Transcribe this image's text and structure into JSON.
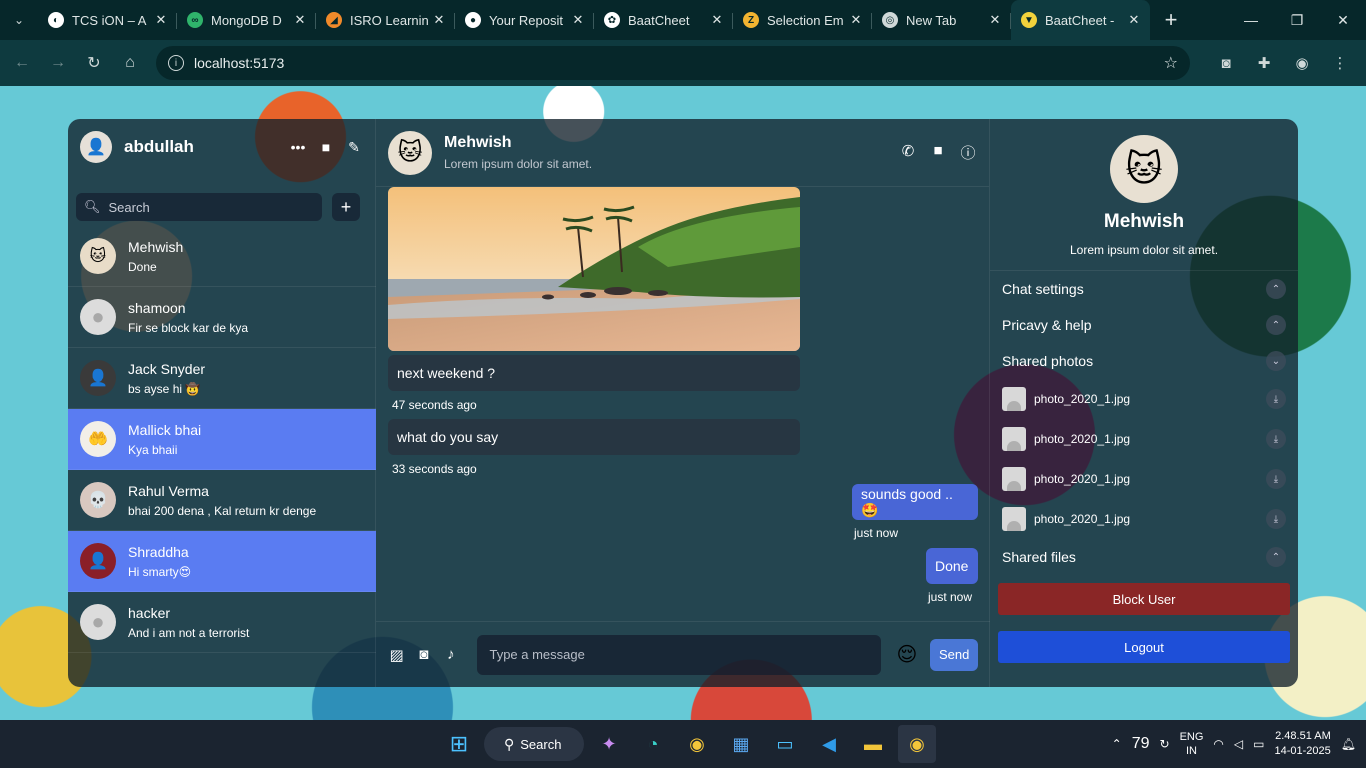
{
  "browser": {
    "tabs": [
      {
        "title": "TCS iON – A",
        "color": "#ffffff",
        "active": false
      },
      {
        "title": "MongoDB D",
        "color": "#2fb36b",
        "active": false
      },
      {
        "title": "ISRO Learnin",
        "color": "#f08a2a",
        "active": false
      },
      {
        "title": "Your Reposit",
        "color": "#ffffff",
        "active": false
      },
      {
        "title": "BaatCheet",
        "color": "#ffffff",
        "active": false
      },
      {
        "title": "Selection Em",
        "color": "#f2b431",
        "active": false
      },
      {
        "title": "New Tab",
        "color": "#cfd8d8",
        "active": false
      },
      {
        "title": "BaatCheet -",
        "color": "#f2d23c",
        "active": true
      }
    ],
    "url": "localhost:5173"
  },
  "user": {
    "name": "abdullah",
    "search_placeholder": "Search"
  },
  "chats": [
    {
      "name": "Mehwish",
      "last": "Done",
      "avatar": "cat",
      "selected": false
    },
    {
      "name": "shamoon",
      "last": "Fir se block kar de kya",
      "avatar": "default",
      "selected": false
    },
    {
      "name": "Jack Snyder",
      "last": "bs ayse hi 🤠",
      "avatar": "photo",
      "selected": false
    },
    {
      "name": "Mallick bhai",
      "last": "Kya bhaii",
      "avatar": "photo",
      "selected": true
    },
    {
      "name": "Rahul Verma",
      "last": "bhai 200 dena , Kal return kr denge",
      "avatar": "photo",
      "selected": false
    },
    {
      "name": "Shraddha",
      "last": "Hi smarty😍",
      "avatar": "photo",
      "selected": true
    },
    {
      "name": "hacker",
      "last": "And i am not a terrorist",
      "avatar": "default",
      "selected": false
    }
  ],
  "chat": {
    "name": "Mehwish",
    "status": "Lorem ipsum dolor sit amet.",
    "messages_in": [
      {
        "text": "next weekend ?",
        "time": "47 seconds ago"
      },
      {
        "text": "what do you say",
        "time": "33 seconds ago"
      }
    ],
    "messages_out": [
      {
        "text": "sounds good ..🤩",
        "time": "just now"
      },
      {
        "text": "Done",
        "time": "just now"
      }
    ],
    "input_placeholder": "Type a message",
    "send_label": "Send"
  },
  "details": {
    "name": "Mehwish",
    "desc": "Lorem ipsum dolor sit amet.",
    "sections": {
      "chat_settings": "Chat settings",
      "privacy": "Pricavy & help",
      "shared_photos": "Shared photos",
      "shared_files": "Shared files"
    },
    "photos": [
      "photo_2020_1.jpg",
      "photo_2020_1.jpg",
      "photo_2020_1.jpg",
      "photo_2020_1.jpg"
    ],
    "block_label": "Block User",
    "logout_label": "Logout"
  },
  "taskbar": {
    "search_label": "Search",
    "temperature": "79",
    "lang_line1": "ENG",
    "lang_line2": "IN",
    "time": "2.48.51 AM",
    "date": "14-01-2025"
  },
  "colors": {
    "accent_selected": "#5a7cf2",
    "outgoing_bubble": "#4966d6",
    "block": "#8a2626",
    "logout": "#1e4fd8"
  }
}
